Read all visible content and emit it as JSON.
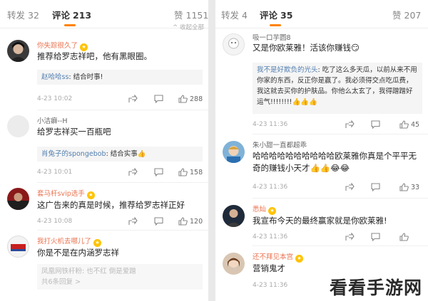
{
  "left": {
    "tabs": {
      "repost": "转发",
      "repost_count": "32",
      "comments": "评论",
      "comments_count": "213",
      "likes": "赞",
      "likes_count": "1151"
    },
    "hint": "^ 收起全部",
    "comments": [
      {
        "user": "你失踪很久了",
        "text": "推荐给罗志祥吧，他有黑眼圈。",
        "reply_user": "赵哈哈ss",
        "reply_text": "结合时事!",
        "time": "4-23 10:02",
        "likes": "288"
      },
      {
        "user": "小洁癖--H",
        "text": "给罗志祥买一百瓶吧",
        "reply_user": "肖兔子的spongebob",
        "reply_text": "结合实事👍",
        "time": "4-23 10:01",
        "likes": "158"
      },
      {
        "user": "套马杆svip选手",
        "text": "这广告来的真是时候，推荐给罗志祥正好",
        "time": "4-23 10:08",
        "likes": "120"
      },
      {
        "user": "我打火机去哪儿了",
        "text": "你是不是在内涵罗志祥",
        "reply_user": "凤凰网铁杆粉",
        "reply_text": "也不红 倒是爱蹭",
        "more": "共6条回复 >"
      }
    ]
  },
  "right": {
    "tabs": {
      "repost": "转发",
      "repost_count": "4",
      "comments": "评论",
      "comments_count": "35",
      "likes": "赞",
      "likes_count": "207"
    },
    "comments": [
      {
        "user": "吸一口芋圆8",
        "text": "又是你欧莱雅！活该你赚钱😏",
        "reply_user": "我不是好欺负的光头",
        "reply_text": "吃了这么多天瓜，以前从来不用你家的东西，反正你是赢了。我必须得交点吃瓜费，我这就去买你的护肤品。你他么太玄了，我得蹭蹭好运气!!!!!!!!👍👍👍",
        "time": "4-23 11:36",
        "likes": "45"
      },
      {
        "user": "朱小甜一直都超乖",
        "text": "哈哈哈哈哈哈哈哈哈哈欧莱雅你真是个平平无奇的赚钱小天才👍👍😂😂",
        "time": "4-23 11:36",
        "likes": "33"
      },
      {
        "user": "悉灿",
        "text": "我宣布今天的最终赢家就是你欧莱雅!",
        "time": "4-23 11:36",
        "likes": ""
      },
      {
        "user": "还不拜见本宫",
        "text": "营销鬼才",
        "time": "4-23 11:36"
      }
    ]
  },
  "watermark": "看看手游网",
  "colors": {
    "accent": "#ff8200",
    "vip_name": "#eb7350",
    "link_name": "#507daf"
  }
}
